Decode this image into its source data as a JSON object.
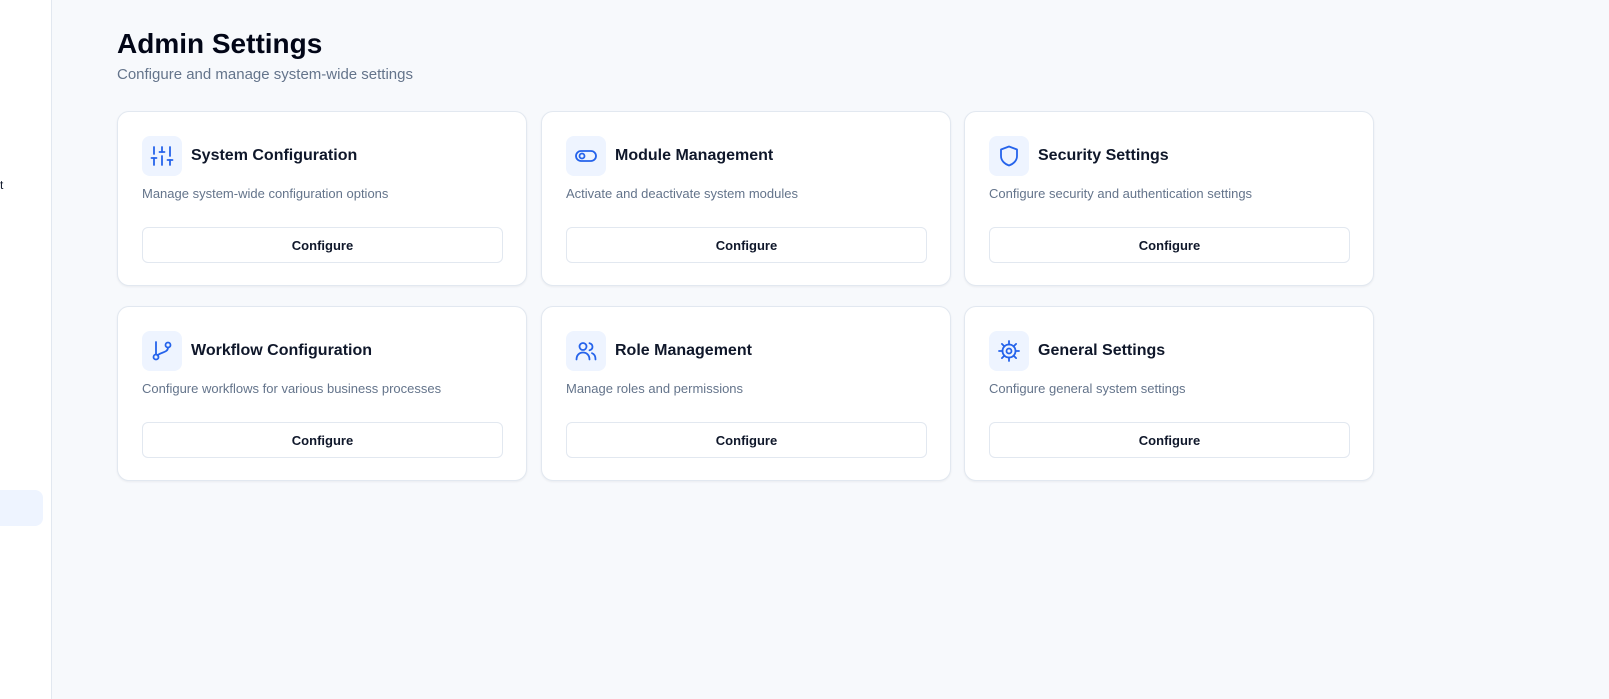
{
  "sidebar": {
    "partial_text": "t"
  },
  "page": {
    "title": "Admin Settings",
    "subtitle": "Configure and manage system-wide settings"
  },
  "cards": [
    {
      "icon": "sliders-icon",
      "title": "System Configuration",
      "description": "Manage system-wide configuration options",
      "button_label": "Configure"
    },
    {
      "icon": "toggle-icon",
      "title": "Module Management",
      "description": "Activate and deactivate system modules",
      "button_label": "Configure"
    },
    {
      "icon": "shield-icon",
      "title": "Security Settings",
      "description": "Configure security and authentication settings",
      "button_label": "Configure"
    },
    {
      "icon": "git-branch-icon",
      "title": "Workflow Configuration",
      "description": "Configure workflows for various business processes",
      "button_label": "Configure"
    },
    {
      "icon": "users-icon",
      "title": "Role Management",
      "description": "Manage roles and permissions",
      "button_label": "Configure"
    },
    {
      "icon": "gear-icon",
      "title": "General Settings",
      "description": "Configure general system settings",
      "button_label": "Configure"
    }
  ],
  "colors": {
    "accent": "#2563eb",
    "icon_bg": "#eef4ff",
    "background": "#f7f9fc",
    "muted_text": "#64748b"
  }
}
